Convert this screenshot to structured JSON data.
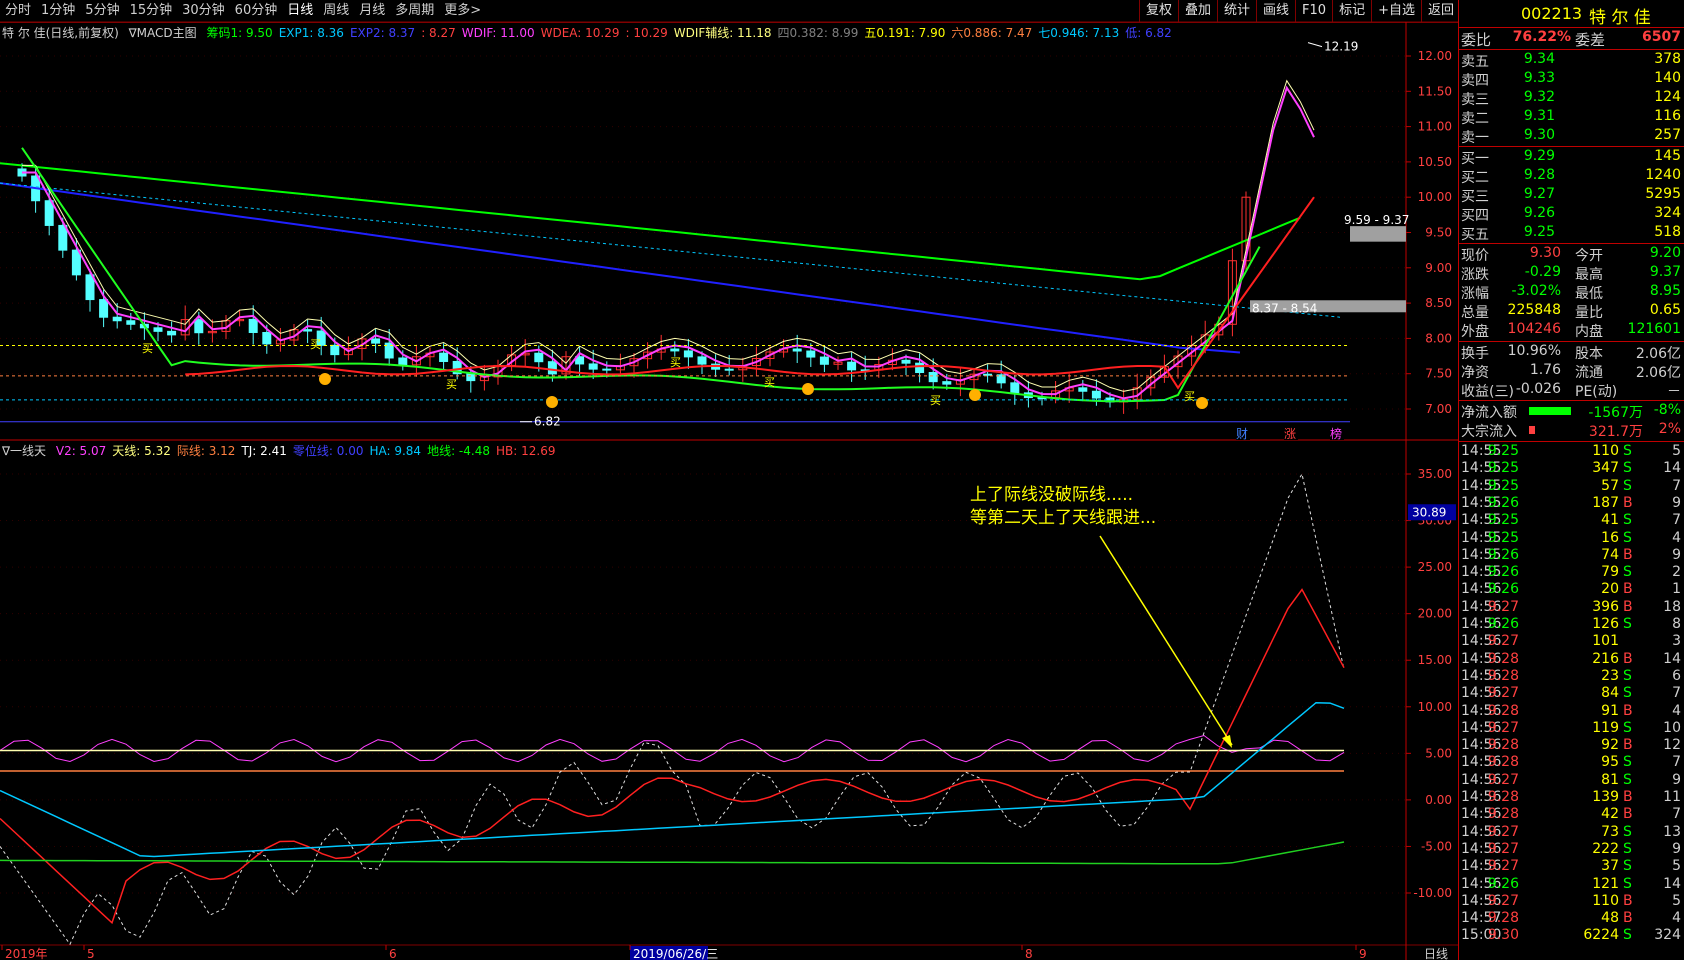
{
  "toolbar": {
    "left": [
      "分时",
      "1分钟",
      "5分钟",
      "15分钟",
      "30分钟",
      "60分钟",
      "日线",
      "周线",
      "月线",
      "多周期",
      "更多>"
    ],
    "active": "日线",
    "right": [
      "复权",
      "叠加",
      "统计",
      "画线",
      "F10",
      "标记",
      "+自选",
      "返回"
    ]
  },
  "main_legend": {
    "title": "特 尔 佳(日线,前复权)",
    "indicator": "∇MACD主图",
    "items": [
      {
        "text": "筹码1: 9.50",
        "color": "#00ff00"
      },
      {
        "text": "EXP1: 8.36",
        "color": "#00c8ff"
      },
      {
        "text": "EXP2: 8.37",
        "color": "#4040ff"
      },
      {
        "text": ": 8.27",
        "color": "#ff4040"
      },
      {
        "text": "WDIF: 11.00",
        "color": "#ff40ff"
      },
      {
        "text": "WDEA: 10.29",
        "color": "#ff4040"
      },
      {
        "text": ": 10.29",
        "color": "#ff4040"
      },
      {
        "text": "WDIF辅线: 11.18",
        "color": "#ffff80"
      },
      {
        "text": "四0.382: 8.99",
        "color": "#808080"
      },
      {
        "text": "五0.191: 7.90",
        "color": "#ffff00"
      },
      {
        "text": "六0.886: 7.47",
        "color": "#ff8040"
      },
      {
        "text": "七0.946: 7.13",
        "color": "#00c8ff"
      },
      {
        "text": "低: 6.82",
        "color": "#4040ff"
      }
    ]
  },
  "price_axis": [
    "12.00",
    "11.50",
    "11.00",
    "10.50",
    "10.00",
    "9.50",
    "9.00",
    "8.50",
    "8.00",
    "7.50",
    "7.00"
  ],
  "price_annotations": {
    "high": "12.19",
    "low": "6.82",
    "band1": "9.59 - 9.37",
    "band2": "8.37 - 8.54",
    "markers": [
      "财",
      "涨",
      "榜"
    ],
    "buy": "买"
  },
  "sub_legend": {
    "title": "∇一线天",
    "items": [
      {
        "text": "V2: 5.07",
        "color": "#ff40ff"
      },
      {
        "text": "天线: 5.32",
        "color": "#ffff80"
      },
      {
        "text": "际线: 3.12",
        "color": "#ff8040"
      },
      {
        "text": "TJ: 2.41",
        "color": "#ffffff"
      },
      {
        "text": "零位线: 0.00",
        "color": "#4040ff"
      },
      {
        "text": "HA: 9.84",
        "color": "#00c8ff"
      },
      {
        "text": "地线: -4.48",
        "color": "#00ff00"
      },
      {
        "text": "HB: 12.69",
        "color": "#ff4040"
      }
    ]
  },
  "sub_axis": [
    "35.00",
    "30.00",
    "25.00",
    "20.00",
    "15.00",
    "10.00",
    "5.00",
    "0.00",
    "-5.00",
    "-10.00"
  ],
  "sub_current": "30.89",
  "annotation": {
    "line1": "上了际线没破际线.....",
    "line2": "等第二天上了天线跟进..."
  },
  "date_axis": {
    "labels": [
      "2019年",
      "5",
      "6",
      "2019/06/26/三",
      "8",
      "9"
    ],
    "period": "日线"
  },
  "quote": {
    "code": "002213",
    "name": "特 尔 佳",
    "webi_label": "委比",
    "webi": "76.22%",
    "weicha_label": "委差",
    "weicha": "6507",
    "sells": [
      {
        "label": "卖五",
        "price": "9.34",
        "vol": "378"
      },
      {
        "label": "卖四",
        "price": "9.33",
        "vol": "140"
      },
      {
        "label": "卖三",
        "price": "9.32",
        "vol": "124"
      },
      {
        "label": "卖二",
        "price": "9.31",
        "vol": "116"
      },
      {
        "label": "卖一",
        "price": "9.30",
        "vol": "257"
      }
    ],
    "buys": [
      {
        "label": "买一",
        "price": "9.29",
        "vol": "145"
      },
      {
        "label": "买二",
        "price": "9.28",
        "vol": "1240"
      },
      {
        "label": "买三",
        "price": "9.27",
        "vol": "5295"
      },
      {
        "label": "买四",
        "price": "9.26",
        "vol": "324"
      },
      {
        "label": "买五",
        "price": "9.25",
        "vol": "518"
      }
    ],
    "stats": [
      {
        "l1": "现价",
        "v1": "9.30",
        "c1": "#ff4040",
        "l2": "今开",
        "v2": "9.20",
        "c2": "#00ff00"
      },
      {
        "l1": "涨跌",
        "v1": "-0.29",
        "c1": "#00ff00",
        "l2": "最高",
        "v2": "9.37",
        "c2": "#00ff00"
      },
      {
        "l1": "涨幅",
        "v1": "-3.02%",
        "c1": "#00ff00",
        "l2": "最低",
        "v2": "8.95",
        "c2": "#00ff00"
      },
      {
        "l1": "总量",
        "v1": "225848",
        "c1": "#ffff00",
        "l2": "量比",
        "v2": "0.65",
        "c2": "#ffff00"
      },
      {
        "l1": "外盘",
        "v1": "104246",
        "c1": "#ff4040",
        "l2": "内盘",
        "v2": "121601",
        "c2": "#00ff00"
      }
    ],
    "stats2": [
      {
        "l1": "换手",
        "v1": "10.96%",
        "l2": "股本",
        "v2": "2.06亿"
      },
      {
        "l1": "净资",
        "v1": "1.76",
        "l2": "流通",
        "v2": "2.06亿"
      },
      {
        "l1": "收益(三)",
        "v1": "-0.026",
        "l2": "PE(动)",
        "v2": "－"
      }
    ],
    "flows": [
      {
        "label": "净流入额",
        "value": "-1567万",
        "pct": "-8%",
        "color": "#00ff00",
        "bar": 0.7
      },
      {
        "label": "大宗流入",
        "value": "321.7万",
        "pct": "2%",
        "color": "#ff4040",
        "bar": 0.05
      }
    ],
    "ticks": [
      [
        "14:55",
        "9.25",
        "110",
        "S",
        "5"
      ],
      [
        "14:55",
        "9.25",
        "347",
        "S",
        "14"
      ],
      [
        "14:55",
        "9.25",
        "57",
        "S",
        "7"
      ],
      [
        "14:55",
        "9.26",
        "187",
        "B",
        "9"
      ],
      [
        "14:55",
        "9.25",
        "41",
        "S",
        "7"
      ],
      [
        "14:55",
        "9.25",
        "16",
        "S",
        "4"
      ],
      [
        "14:55",
        "9.26",
        "74",
        "B",
        "9"
      ],
      [
        "14:55",
        "9.26",
        "79",
        "S",
        "2"
      ],
      [
        "14:56",
        "9.26",
        "20",
        "B",
        "1"
      ],
      [
        "14:56",
        "9.27",
        "396",
        "B",
        "18"
      ],
      [
        "14:56",
        "9.26",
        "126",
        "S",
        "8"
      ],
      [
        "14:56",
        "9.27",
        "101",
        "",
        "3"
      ],
      [
        "14:56",
        "9.28",
        "216",
        "B",
        "14"
      ],
      [
        "14:56",
        "9.28",
        "23",
        "S",
        "6"
      ],
      [
        "14:56",
        "9.27",
        "84",
        "S",
        "7"
      ],
      [
        "14:56",
        "9.28",
        "91",
        "B",
        "4"
      ],
      [
        "14:56",
        "9.27",
        "119",
        "S",
        "10"
      ],
      [
        "14:56",
        "9.28",
        "92",
        "B",
        "12"
      ],
      [
        "14:56",
        "9.28",
        "95",
        "S",
        "7"
      ],
      [
        "14:56",
        "9.27",
        "81",
        "S",
        "9"
      ],
      [
        "14:56",
        "9.28",
        "139",
        "B",
        "11"
      ],
      [
        "14:56",
        "9.28",
        "42",
        "B",
        "7"
      ],
      [
        "14:56",
        "9.27",
        "73",
        "S",
        "13"
      ],
      [
        "14:56",
        "9.27",
        "222",
        "S",
        "9"
      ],
      [
        "14:56",
        "9.27",
        "37",
        "S",
        "5"
      ],
      [
        "14:56",
        "9.26",
        "121",
        "S",
        "14"
      ],
      [
        "14:56",
        "9.27",
        "110",
        "B",
        "5"
      ],
      [
        "14:57",
        "9.28",
        "48",
        "B",
        "4"
      ],
      [
        "15:00",
        "9.30",
        "6224",
        "S",
        "324"
      ]
    ]
  }
}
